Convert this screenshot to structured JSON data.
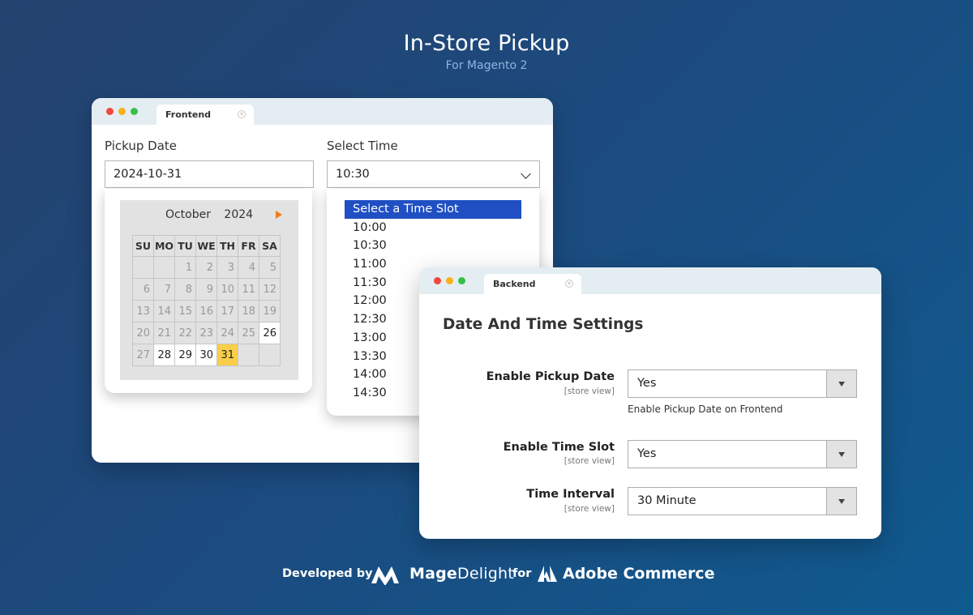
{
  "header": {
    "title": "In-Store Pickup",
    "subtitle": "For Magento 2"
  },
  "frontend": {
    "tab_label": "Frontend",
    "pickup_date_label": "Pickup Date",
    "pickup_date_value": "2024-10-31",
    "select_time_label": "Select Time",
    "select_time_value": "10:30",
    "calendar": {
      "month": "October",
      "year": "2024",
      "weekdays": [
        "SU",
        "MO",
        "TU",
        "WE",
        "TH",
        "FR",
        "SA"
      ],
      "weeks": [
        [
          "",
          "",
          "1",
          "2",
          "3",
          "4",
          "5"
        ],
        [
          "6",
          "7",
          "8",
          "9",
          "10",
          "11",
          "12"
        ],
        [
          "13",
          "14",
          "15",
          "16",
          "17",
          "18",
          "19"
        ],
        [
          "20",
          "21",
          "22",
          "23",
          "24",
          "25",
          "26"
        ],
        [
          "27",
          "28",
          "29",
          "30",
          "31",
          "",
          ""
        ]
      ],
      "selected_day": "31",
      "selected_color": "#f9cf49"
    },
    "time_options": [
      "Select a Time Slot",
      "10:00",
      "10:30",
      "11:00",
      "11:30",
      "12:00",
      "12:30",
      "13:00",
      "13:30",
      "14:00",
      "14:30"
    ],
    "highlight_color": "#1f4fc3"
  },
  "backend": {
    "tab_label": "Backend",
    "section_title": "Date And Time Settings",
    "rows": [
      {
        "label": "Enable Pickup Date",
        "scope": "[store view]",
        "value": "Yes",
        "note": "Enable Pickup Date on Frontend"
      },
      {
        "label": "Enable Time Slot",
        "scope": "[store view]",
        "value": "Yes",
        "note": ""
      },
      {
        "label": "Time Interval",
        "scope": "[store view]",
        "value": "30 Minute",
        "note": ""
      }
    ]
  },
  "footer": {
    "developed_by": "Developed by",
    "brand_bold": "Mage",
    "brand_light": "Delight",
    "for_text": "for",
    "platform": "Adobe Commerce"
  },
  "icons": [
    "close-icon",
    "chevron-down-icon",
    "arrow-right-icon",
    "magedelight-logo",
    "adobe-logo"
  ]
}
